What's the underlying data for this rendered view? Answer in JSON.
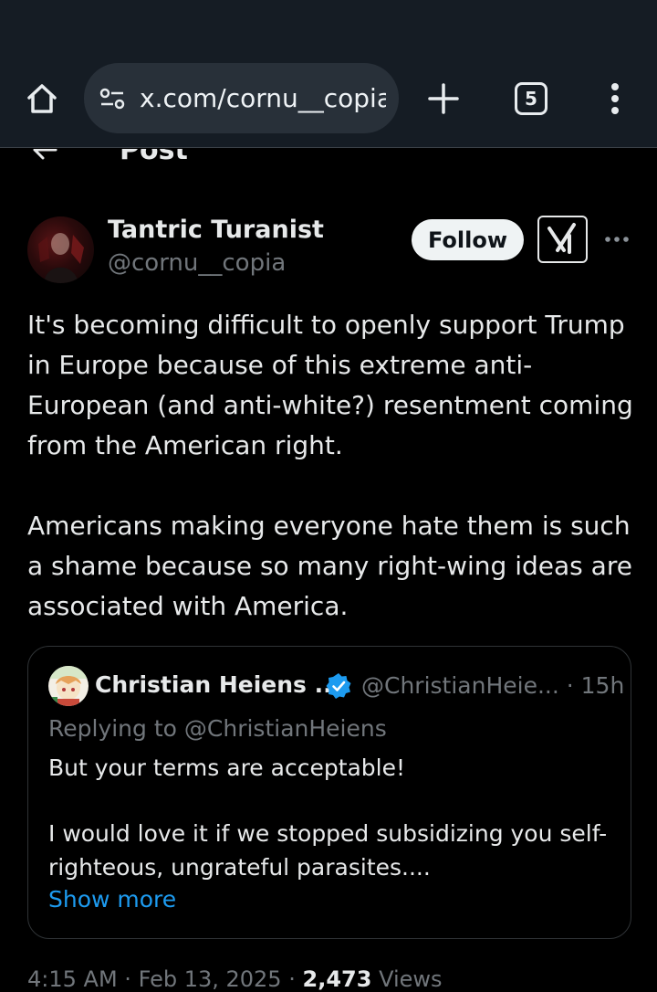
{
  "browser": {
    "url": "x.com/cornu__copia",
    "tab_count": "5"
  },
  "header": {
    "title": "Post"
  },
  "post": {
    "author_name": "Tantric Turanist",
    "author_handle": "@cornu__copia",
    "follow_label": "Follow",
    "paragraph1": "It's becoming difficult to openly support Trump in Europe because of this extreme anti-European (and anti-white?) resentment coming from the American right.",
    "paragraph2": "Americans making everyone hate them is such a shame because so many right-wing ideas are associated with America.",
    "time": "4:15 AM",
    "date": "Feb 13, 2025",
    "views_count": "2,473",
    "views_label": "Views",
    "separator": "·"
  },
  "quote": {
    "author_name": "Christian Heiens ...",
    "handle_time": "@ChristianHeie... · 15h",
    "replying_prefix": "Replying to",
    "replying_handle": "@ChristianHeiens",
    "paragraph1": "But your terms are acceptable!",
    "paragraph2": "I would love it if we stopped subsidizing you self-righteous, ungrateful parasites....",
    "show_more": "Show more"
  },
  "colors": {
    "background": "#000000",
    "browser_bar": "#151c24",
    "link": "#1d9bf0",
    "muted": "#71767b",
    "verified": "#1d9bf0"
  },
  "icons": {
    "home": "home-icon",
    "site_info": "site-settings-icon",
    "new_tab": "plus-icon",
    "tabs": "tab-switcher-icon",
    "menu": "kebab-menu-icon",
    "back": "back-arrow-icon",
    "grok": "grok-icon",
    "more": "more-horizontal-icon",
    "verified": "verified-badge-icon"
  }
}
